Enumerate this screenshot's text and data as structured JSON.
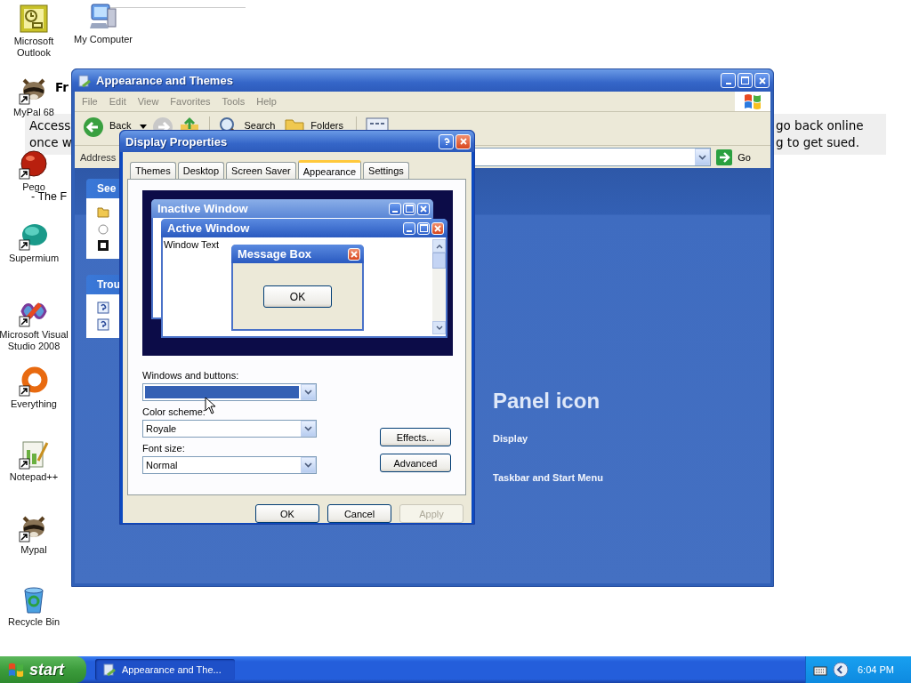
{
  "desktop": {
    "background_page": {
      "heading": "Fr",
      "left_lines": [
        "Access",
        "once w"
      ],
      "right_lines": [
        "go back online",
        "g to get sued."
      ],
      "footer": "- The F"
    },
    "icons": [
      {
        "label": "Microsoft Outlook",
        "kind": "outlook",
        "shortcut": false
      },
      {
        "label": "My Computer",
        "kind": "computer",
        "shortcut": false
      },
      {
        "label": "MyPal 68",
        "kind": "raccoon",
        "shortcut": true
      },
      {
        "label": "Pego",
        "kind": "ball",
        "shortcut": true
      },
      {
        "label": "Supermium",
        "kind": "blob",
        "shortcut": true
      },
      {
        "label": "Microsoft Visual Studio 2008",
        "kind": "infinity",
        "shortcut": true
      },
      {
        "label": "Everything",
        "kind": "ring",
        "shortcut": true
      },
      {
        "label": "Notepad++",
        "kind": "notepad",
        "shortcut": true
      },
      {
        "label": "Mypal",
        "kind": "raccoon",
        "shortcut": true
      },
      {
        "label": "Recycle Bin",
        "kind": "bin",
        "shortcut": false
      }
    ]
  },
  "explorer": {
    "title": "Appearance and Themes",
    "menu": [
      {
        "label": "File",
        "disabled": true
      },
      {
        "label": "Edit",
        "disabled": true
      },
      {
        "label": "View",
        "disabled": true
      },
      {
        "label": "Favorites",
        "disabled": true
      },
      {
        "label": "Tools",
        "disabled": true
      },
      {
        "label": "Help",
        "disabled": true
      }
    ],
    "toolbar": {
      "back": "Back",
      "search": "Search",
      "folders": "Folders"
    },
    "address": {
      "label": "Address",
      "go": "Go"
    },
    "sidebar": [
      {
        "header": "See"
      },
      {
        "header": "Trou"
      }
    ],
    "main": {
      "heading": "Panel icon",
      "links": [
        "Display",
        "Taskbar and Start Menu"
      ]
    }
  },
  "dialog": {
    "title": "Display Properties",
    "tabs": [
      {
        "label": "Themes",
        "selected": false
      },
      {
        "label": "Desktop",
        "selected": false
      },
      {
        "label": "Screen Saver",
        "selected": false
      },
      {
        "label": "Appearance",
        "selected": true
      },
      {
        "label": "Settings",
        "selected": false
      }
    ],
    "preview": {
      "inactive_title": "Inactive Window",
      "active_title": "Active Window",
      "window_text": "Window Text",
      "message_title": "Message Box",
      "message_button": "OK"
    },
    "fields": [
      {
        "label": "Windows and buttons:",
        "highlighted": true
      },
      {
        "label": "Color scheme:",
        "value": "Royale",
        "highlighted": false
      },
      {
        "label": "Font size:",
        "value": "Normal",
        "highlighted": false
      }
    ],
    "side_buttons": [
      "Effects...",
      "Advanced"
    ],
    "buttons": [
      {
        "label": "OK",
        "disabled": false
      },
      {
        "label": "Cancel",
        "disabled": false
      },
      {
        "label": "Apply",
        "disabled": true
      }
    ]
  },
  "taskbar": {
    "start": "start",
    "tasks": [
      "Appearance and The..."
    ],
    "clock": "6:04 PM"
  }
}
